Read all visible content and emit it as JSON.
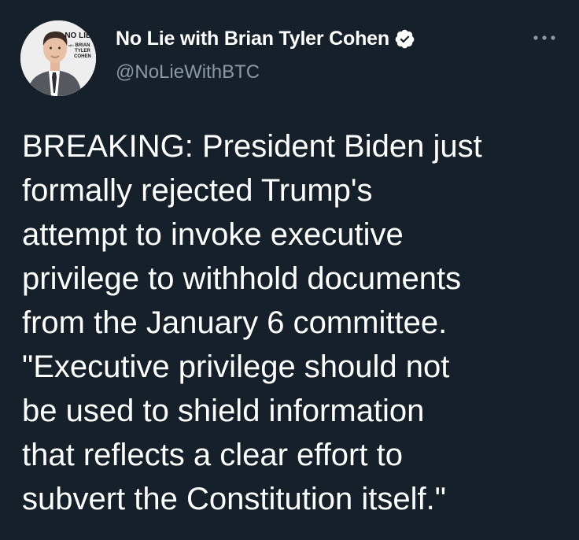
{
  "author": {
    "display_name": "No Lie with Brian Tyler Cohen",
    "handle": "@NoLieWithBTC",
    "verified": true,
    "avatar": {
      "logo_text": [
        "NO LIE",
        "with",
        "BRIAN",
        "TYLER",
        "COHEN"
      ]
    }
  },
  "menu": {
    "icon": "more-horizontal-icon"
  },
  "tweet": {
    "lines": [
      "BREAKING: President Biden just",
      "formally rejected Trump's",
      "attempt to invoke executive",
      "privilege to withhold documents",
      "from the January 6 committee.",
      "\"Executive privilege should not",
      "be used to shield information",
      "that reflects a clear effort to",
      "subvert the Constitution itself.\""
    ]
  },
  "colors": {
    "background": "#15202b",
    "text_primary": "#ffffff",
    "text_secondary": "#8b98a5",
    "verified_badge": "#ffffff"
  }
}
